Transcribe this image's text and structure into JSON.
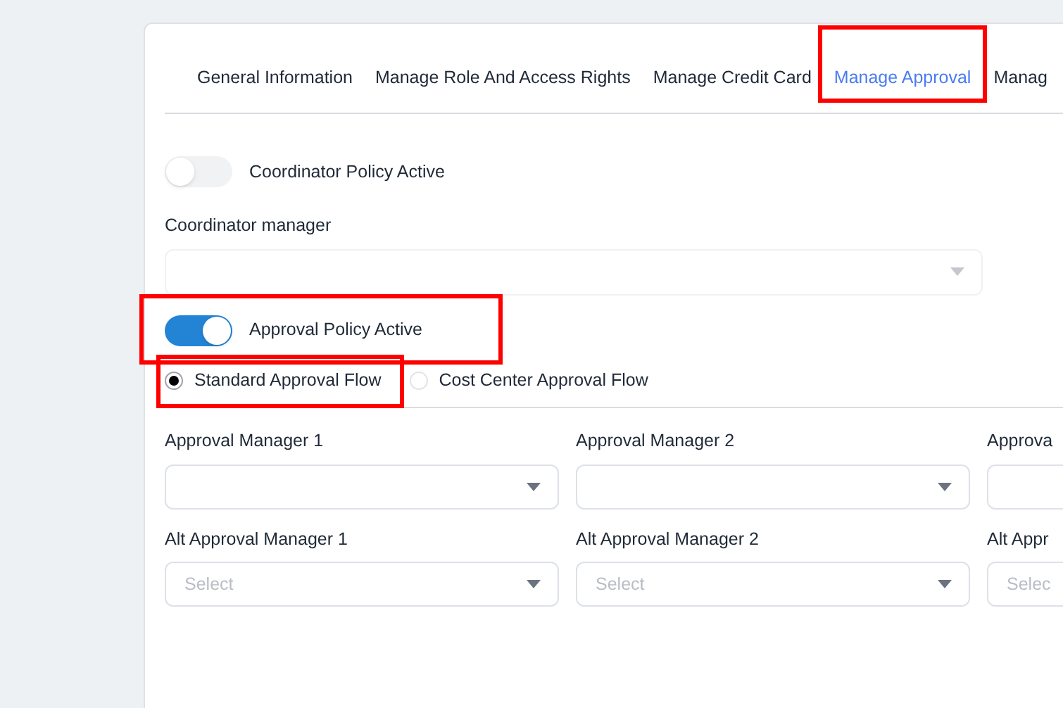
{
  "tabs": [
    {
      "label": "General Information",
      "selected": false,
      "highlighted": false
    },
    {
      "label": "Manage Role And Access Rights",
      "selected": false,
      "highlighted": false
    },
    {
      "label": "Manage Credit Card",
      "selected": false,
      "highlighted": false
    },
    {
      "label": "Manage Approval",
      "selected": true,
      "highlighted": true
    },
    {
      "label": "Manag",
      "selected": false,
      "highlighted": false
    }
  ],
  "coordinator_toggle": {
    "label": "Coordinator Policy Active",
    "on": false,
    "highlighted": false
  },
  "coordinator_manager": {
    "label": "Coordinator manager"
  },
  "approval_toggle": {
    "label": "Approval Policy Active",
    "on": true,
    "highlighted": true
  },
  "flow_options": [
    {
      "label": "Standard Approval Flow",
      "selected": true,
      "highlighted": true
    },
    {
      "label": "Cost Center Approval Flow",
      "selected": false,
      "highlighted": false
    }
  ],
  "managers": [
    {
      "label": "Approval Manager 1"
    },
    {
      "label": "Approval Manager 2"
    },
    {
      "label": "Approva"
    },
    {
      "label": "Alt Approval Manager 1",
      "placeholder": "Select"
    },
    {
      "label": "Alt Approval Manager 2",
      "placeholder": "Select"
    },
    {
      "label": "Alt Appr",
      "placeholder": "Selec"
    }
  ]
}
